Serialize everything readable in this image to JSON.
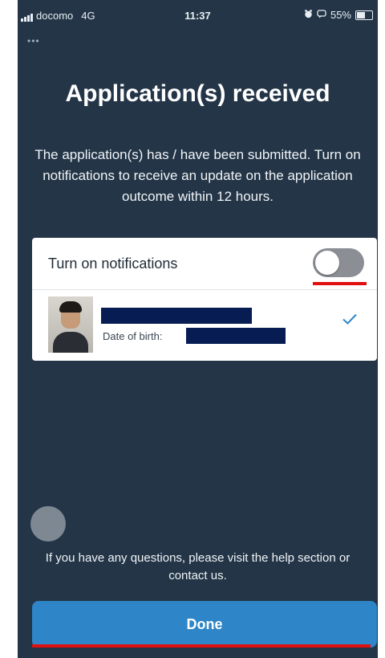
{
  "status_bar": {
    "carrier": "docomo",
    "network": "4G",
    "time": "11:37",
    "battery": "55%",
    "battery_level": 0.55
  },
  "title": "Application(s) received",
  "description": "The application(s) has / have been submitted. Turn on notifications to receive an update on the application outcome within 12 hours.",
  "notifications": {
    "label": "Turn on notifications",
    "enabled": false
  },
  "applicant": {
    "dob_label": "Date of birth:",
    "verified_icon": "checkmark-icon"
  },
  "help_text": "If you have any questions, please visit the help section or contact us.",
  "done_button": "Done",
  "colors": {
    "background": "#233547",
    "accent": "#2e86c8",
    "annotation": "#e01010",
    "redaction": "#061c52"
  }
}
